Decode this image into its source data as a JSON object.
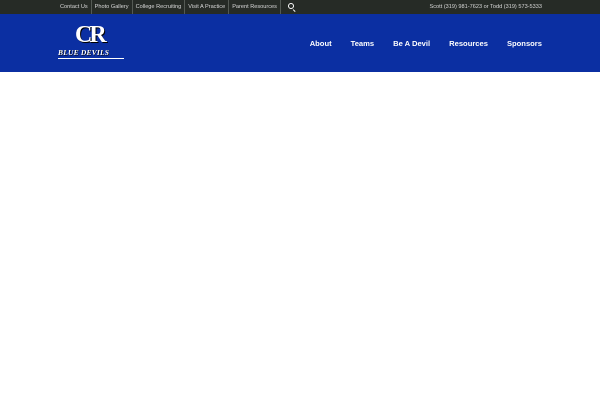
{
  "topbar": {
    "links": [
      "Contact Us",
      "Photo Gallery",
      "College Recruiting",
      "Visit A Practice",
      "Parent Resources"
    ],
    "contact": "Scott (319) 981-7623 or Todd (319) 573-5333",
    "search_icon": "search-icon"
  },
  "logo": {
    "mark": "CR",
    "text": "BLUE DEVILS"
  },
  "nav": {
    "items": [
      "About",
      "Teams",
      "Be A Devil",
      "Resources",
      "Sponsors"
    ]
  },
  "colors": {
    "topbar_bg": "#262b26",
    "header_bg": "#0b2fa2",
    "text_light": "#ffffff"
  }
}
